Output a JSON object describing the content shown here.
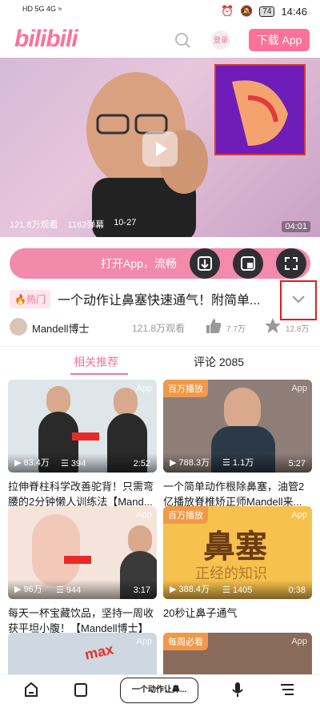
{
  "status": {
    "left_icons": "HD 5G 4G ≈",
    "battery": "74",
    "time": "14:46"
  },
  "header": {
    "logo": "bilibili",
    "login": "登录",
    "download_app": "下载 App"
  },
  "video": {
    "views": "121.8万观看",
    "danmaku": "1162弹幕",
    "date": "10-27",
    "duration": "04:01"
  },
  "open_app_bar": {
    "text": "打开App，流畅"
  },
  "info": {
    "hot_tag": "热门",
    "title": "一个动作让鼻塞快速通气！附简单...",
    "uploader": "Mandell博士",
    "views": "121.8万观看",
    "likes": "7.7万",
    "favorites": "12.8万"
  },
  "tabs": {
    "related": "相关推荐",
    "comments": "评论 2085"
  },
  "cards": [
    {
      "views": "83.4万",
      "danmaku": "394",
      "duration": "2:52",
      "app_tag": "App",
      "badge": "",
      "title": "拉伸脊柱科学改善驼背！只需弯腰的2分钟懒人训练法【Mand..."
    },
    {
      "views": "788.3万",
      "danmaku": "1.1万",
      "duration": "5:27",
      "app_tag": "App",
      "badge": "百万播放",
      "title": "一个简单动作根除鼻塞，油管2亿播放脊椎矫正师Mandell来..."
    },
    {
      "views": "96万",
      "danmaku": "944",
      "duration": "3:17",
      "app_tag": "App",
      "badge": "",
      "title": "每天一杯宝藏饮品，坚持一周收获平坦小腹！【Mandell博士】"
    },
    {
      "views": "388.4万",
      "danmaku": "1405",
      "duration": "0:38",
      "app_tag": "App",
      "badge": "百万播放",
      "title": "20秒让鼻子通气",
      "thumb_text": "鼻塞",
      "thumb_sub": "正经的知识"
    },
    {
      "app_tag": "App",
      "badge": "",
      "thumb_text": "max"
    },
    {
      "app_tag": "App",
      "badge": "每周必看"
    }
  ],
  "bottom_bar": {
    "pill": "一个动作让鼻..."
  },
  "colors": {
    "brand_pink": "#fb7299",
    "badge_orange": "#f29949",
    "highlight_red": "#e51c1c"
  }
}
